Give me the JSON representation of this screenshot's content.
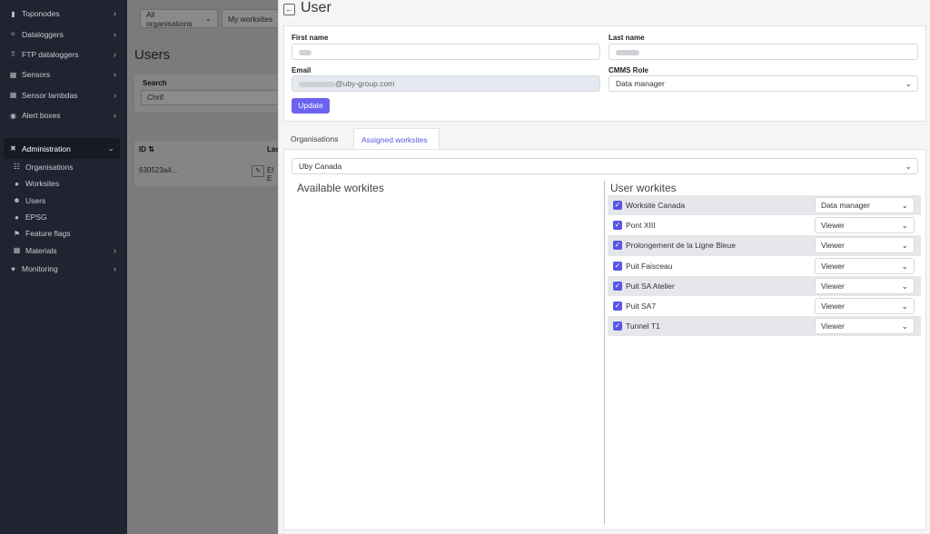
{
  "sidebar": {
    "items": [
      {
        "label": "Toponodes",
        "icon": "video-icon"
      },
      {
        "label": "Dataloggers",
        "icon": "wifi-icon"
      },
      {
        "label": "FTP dataloggers",
        "icon": "upload-icon"
      },
      {
        "label": "Sensors",
        "icon": "sensor-icon"
      },
      {
        "label": "Sensor lambdas",
        "icon": "sensor-icon"
      },
      {
        "label": "Alert boxes",
        "icon": "bell-icon"
      }
    ],
    "admin": {
      "label": "Administration",
      "icon": "tools-icon"
    },
    "sub_items": [
      {
        "label": "Organisations",
        "icon": "org-icon"
      },
      {
        "label": "Worksites",
        "icon": "pin-icon"
      },
      {
        "label": "Users",
        "icon": "users-icon"
      },
      {
        "label": "EPSG",
        "icon": "globe-icon"
      },
      {
        "label": "Feature flags",
        "icon": "flag-icon"
      },
      {
        "label": "Materials",
        "icon": "box-icon"
      }
    ],
    "monitoring": {
      "label": "Monitoring",
      "icon": "heart-icon"
    }
  },
  "background_page": {
    "filter_org": "All organisations",
    "filter_ws": "My worksites",
    "title": "Users",
    "search_label": "Search",
    "search_value": "Chrif",
    "col_id": "ID",
    "col_last": "Las",
    "row_id": "630523a4...",
    "row_last": "El E"
  },
  "drawer": {
    "title": "User",
    "first_name_label": "First name",
    "last_name_label": "Last name",
    "email_label": "Email",
    "email_value": "@uby-group.com",
    "role_label": "CMMS Role",
    "role_value": "Data manager",
    "update_label": "Update",
    "tabs": [
      "Organisations",
      "Assigned worksites"
    ],
    "org_select": "Uby Canada",
    "available_title": "Available workites",
    "user_title": "User workites",
    "worksites": [
      {
        "name": "Worksite Canada",
        "role": "Data manager"
      },
      {
        "name": "Pont XIII",
        "role": "Viewer"
      },
      {
        "name": "Prolongement de la Ligne Bleue",
        "role": "Viewer"
      },
      {
        "name": "Puit Faisceau",
        "role": "Viewer"
      },
      {
        "name": "Puit SA Atelier",
        "role": "Viewer"
      },
      {
        "name": "Puit SA7",
        "role": "Viewer"
      },
      {
        "name": "Tunnel T1",
        "role": "Viewer"
      }
    ]
  },
  "colors": {
    "accent": "#6c63f0",
    "sidebar_bg": "#1f2430"
  }
}
